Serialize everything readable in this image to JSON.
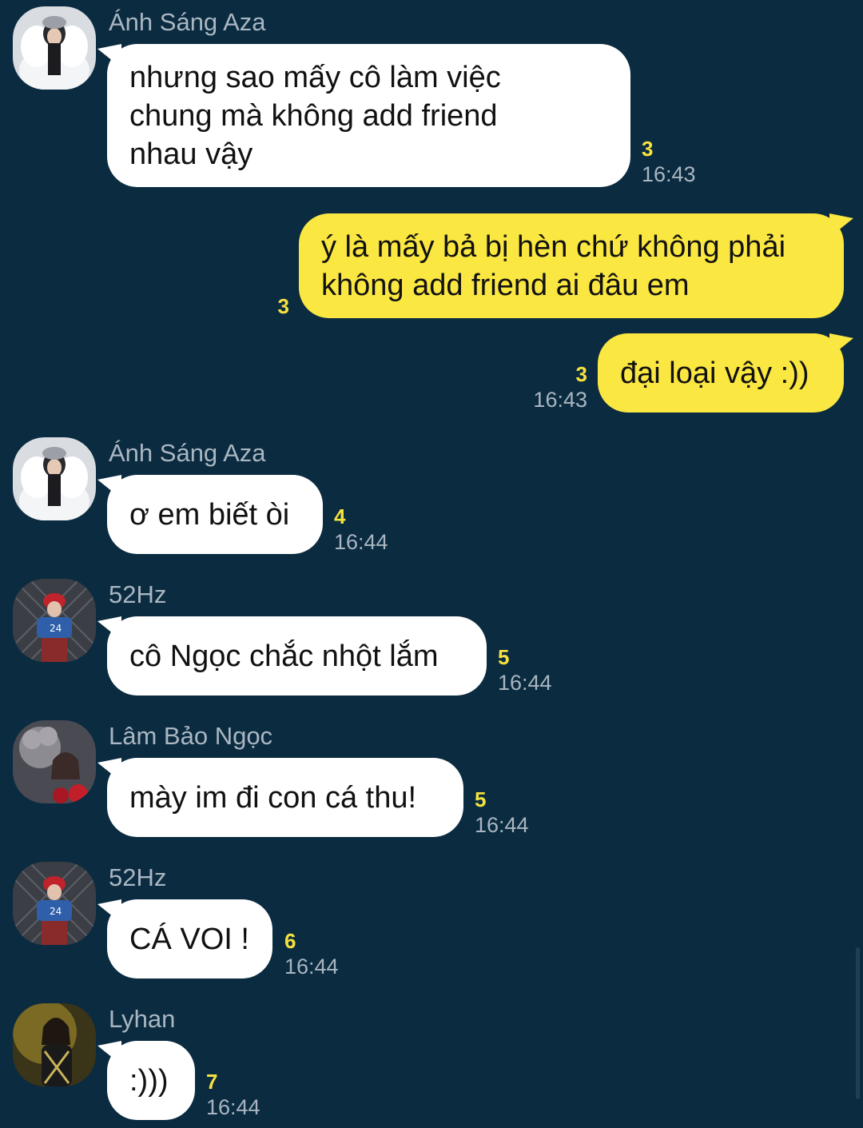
{
  "messages": [
    {
      "sender": "Ánh Sáng Aza",
      "text": "nhưng sao mấy cô làm việc\nchung mà không add friend\nnhau vậy",
      "read_count": "3",
      "time": "16:43",
      "avatar": "avatar-anh-sang-aza"
    },
    {
      "text": "ý là mấy bả bị hèn chứ không phải\nkhông add friend ai đâu em",
      "read_count": "3",
      "time": ""
    },
    {
      "text": "đại loại vậy :))",
      "read_count": "3",
      "time": "16:43"
    },
    {
      "sender": "Ánh Sáng Aza",
      "text": "ơ em biết òi",
      "read_count": "4",
      "time": "16:44",
      "avatar": "avatar-anh-sang-aza"
    },
    {
      "sender": "52Hz",
      "text": "cô Ngọc chắc nhột lắm",
      "read_count": "5",
      "time": "16:44",
      "avatar": "avatar-52hz"
    },
    {
      "sender": "Lâm Bảo Ngọc",
      "text": "mày im đi con cá thu!",
      "read_count": "5",
      "time": "16:44",
      "avatar": "avatar-lam-bao-ngoc"
    },
    {
      "sender": "52Hz",
      "text": "CÁ VOI !",
      "read_count": "6",
      "time": "16:44",
      "avatar": "avatar-52hz"
    },
    {
      "sender": "Lyhan",
      "text": ":)))",
      "read_count": "7",
      "time": "16:44",
      "avatar": "avatar-lyhan"
    }
  ],
  "colors": {
    "background": "#0b2b40",
    "incoming_bubble": "#ffffff",
    "outgoing_bubble": "#fbe741",
    "read_count": "#f6e23e",
    "timestamp": "#a9b6c1",
    "sender_name": "#aab7c2"
  }
}
